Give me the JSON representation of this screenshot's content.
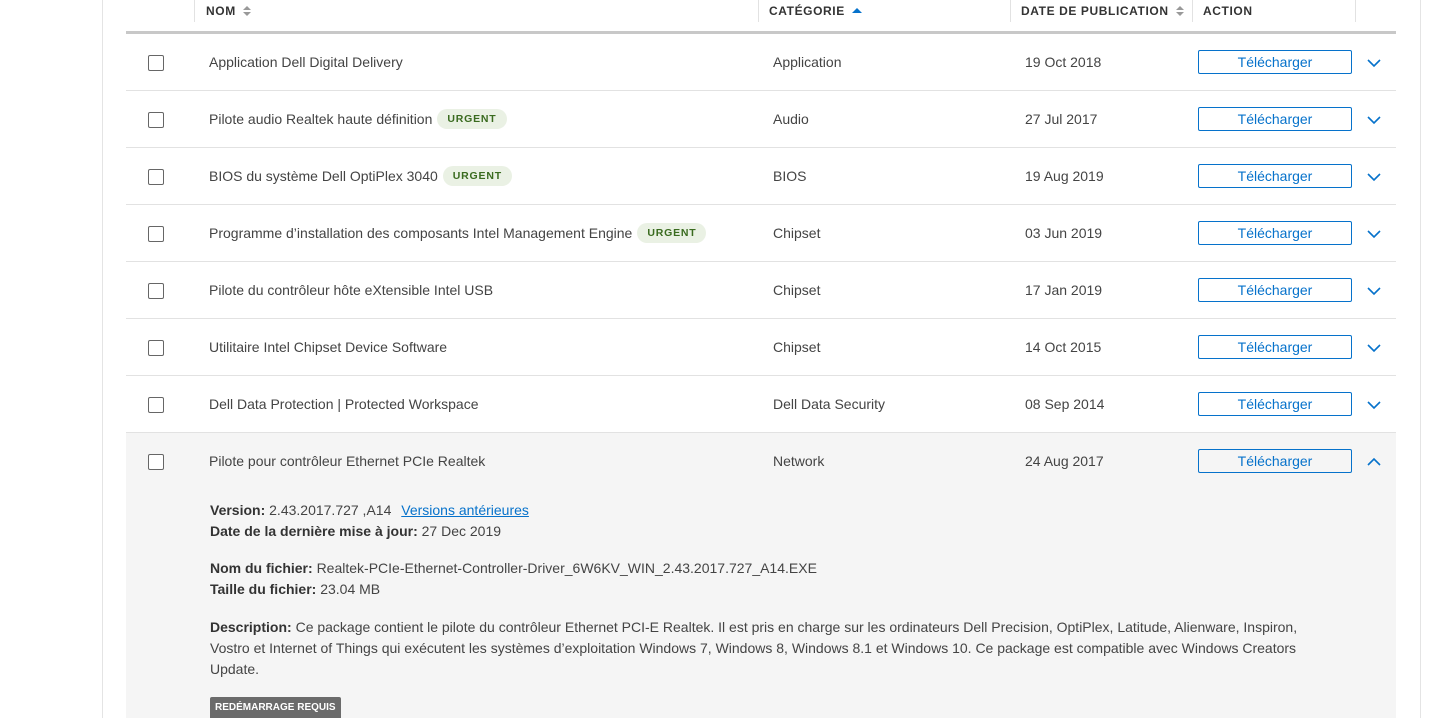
{
  "header": {
    "name": "NOM",
    "category": "CATÉGORIE",
    "date": "DATE DE PUBLICATION",
    "action": "ACTION"
  },
  "rows": [
    {
      "name": "Application Dell Digital Delivery",
      "badge": "",
      "category": "Application",
      "date": "19 Oct 2018",
      "action": "Télécharger"
    },
    {
      "name": "Pilote audio Realtek haute définition",
      "badge": "URGENT",
      "category": "Audio",
      "date": "27 Jul 2017",
      "action": "Télécharger"
    },
    {
      "name": "BIOS du système Dell OptiPlex 3040",
      "badge": "URGENT",
      "category": "BIOS",
      "date": "19 Aug 2019",
      "action": "Télécharger"
    },
    {
      "name": "Programme d’installation des composants Intel Management Engine",
      "badge": "URGENT",
      "category": "Chipset",
      "date": "03 Jun 2019",
      "action": "Télécharger"
    },
    {
      "name": "Pilote du contrôleur hôte eXtensible Intel USB",
      "badge": "",
      "category": "Chipset",
      "date": "17 Jan 2019",
      "action": "Télécharger"
    },
    {
      "name": "Utilitaire Intel Chipset Device Software",
      "badge": "",
      "category": "Chipset",
      "date": "14 Oct 2015",
      "action": "Télécharger"
    },
    {
      "name": "Dell Data Protection | Protected Workspace",
      "badge": "",
      "category": "Dell Data Security",
      "date": "08 Sep 2014",
      "action": "Télécharger"
    },
    {
      "name": "Pilote pour contrôleur Ethernet PCIe Realtek",
      "badge": "",
      "category": "Network",
      "date": "24 Aug 2017",
      "action": "Télécharger"
    }
  ],
  "details": {
    "version_label": "Version:",
    "version_value": "2.43.2017.727 ,A14",
    "previous_versions_link": "Versions antérieures",
    "last_update_label": "Date de la dernière mise à jour:",
    "last_update_value": "27 Dec 2019",
    "filename_label": "Nom du fichier:",
    "filename_value": "Realtek-PCIe-Ethernet-Controller-Driver_6W6KV_WIN_2.43.2017.727_A14.EXE",
    "filesize_label": "Taille du fichier:",
    "filesize_value": "23.04 MB",
    "description_label": "Description:",
    "description_value": "Ce package contient le pilote du contrôleur Ethernet PCI-E Realtek. Il est pris en charge sur les ordinateurs Dell Precision, OptiPlex, Latitude, Alienware, Inspiron, Vostro et Internet of Things qui exécutent les systèmes d’exploitation Windows 7, Windows 8, Windows 8.1 et Windows 10. Ce package est compatible avec Windows Creators Update.",
    "reboot_badge": "REDÉMARRAGE REQUIS"
  },
  "colors": {
    "accent": "#0672cb",
    "badge_bg": "#eaf1e4",
    "badge_text": "#3a6b1f",
    "expanded_bg": "#f5f5f5",
    "reboot_bg": "#6b6b6b"
  },
  "icons": {
    "sort": "sort-arrows-icon",
    "sort_active": "sort-ascending-icon",
    "expand": "chevron-down-icon",
    "collapse": "chevron-up-icon"
  }
}
